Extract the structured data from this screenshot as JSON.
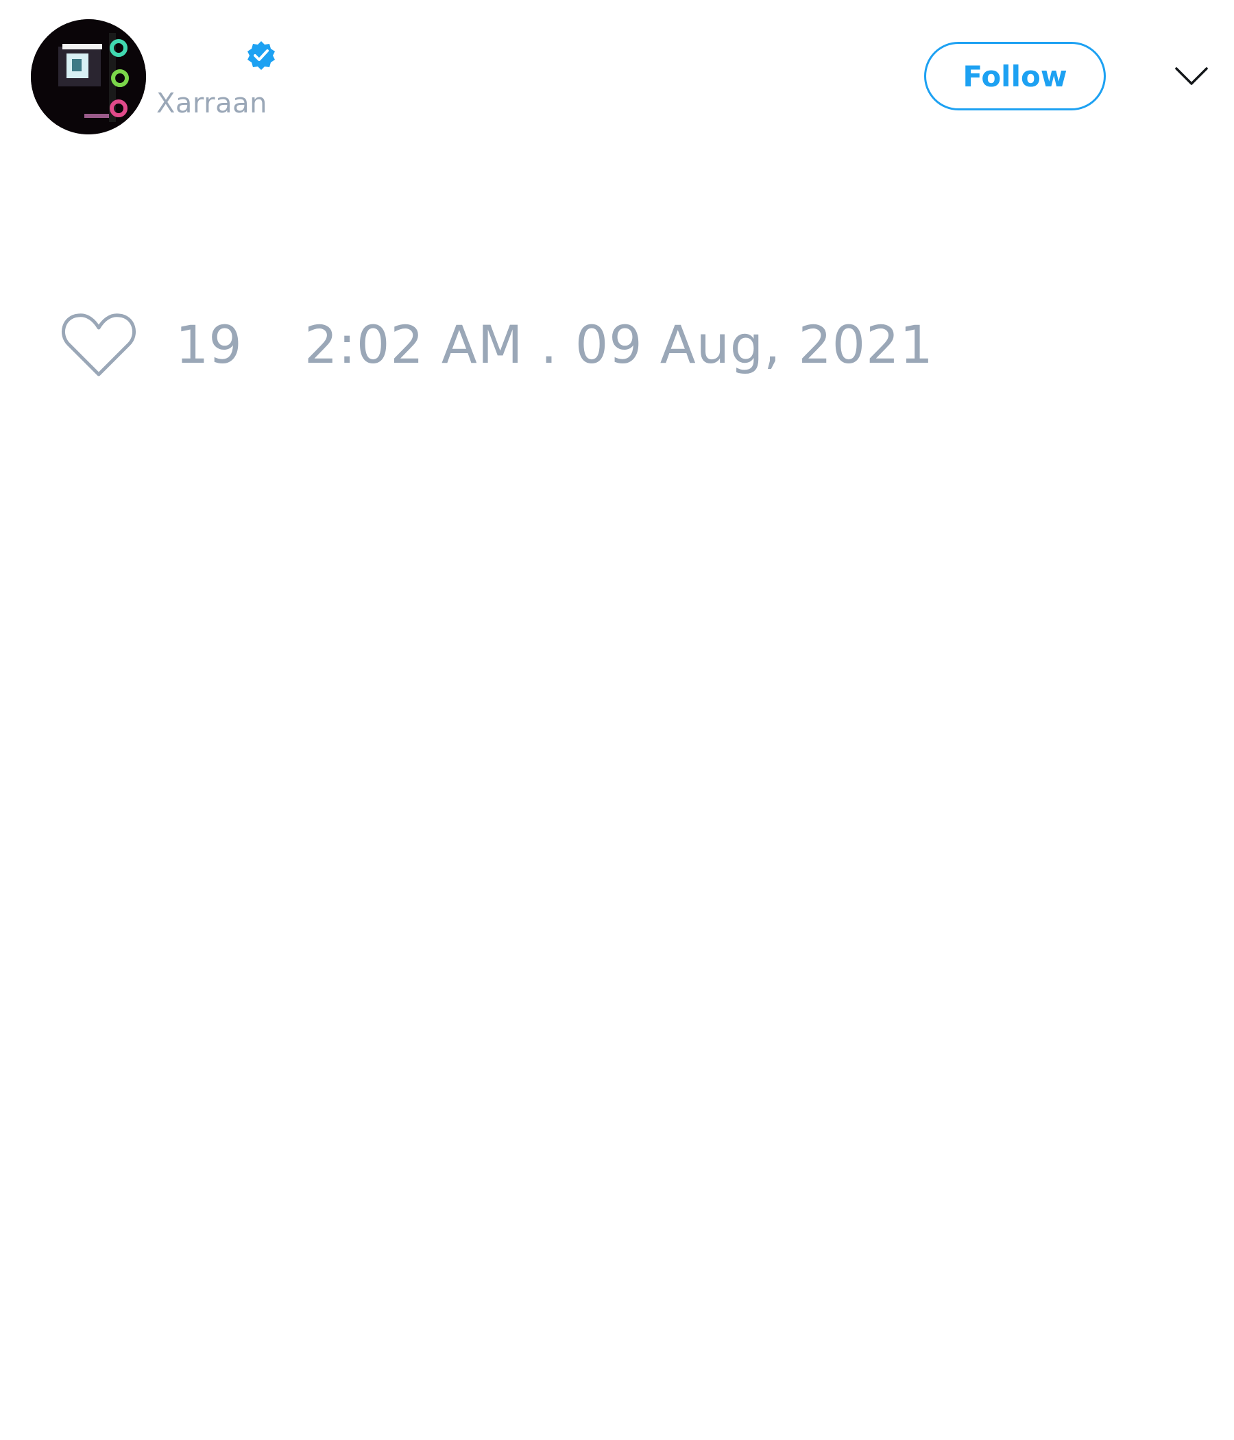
{
  "author": {
    "handle": "Xarraan",
    "verified": true,
    "avatar_icon": "avatar-image"
  },
  "actions": {
    "follow_label": "Follow",
    "menu_icon": "chevron-down-icon"
  },
  "footer": {
    "like_icon": "heart-icon",
    "like_count": "19",
    "timestamp": "2:02 AM . 09 Aug, 2021"
  },
  "colors": {
    "accent": "#1da1f2",
    "muted_text": "#9aa7b7",
    "background": "#ffffff"
  }
}
